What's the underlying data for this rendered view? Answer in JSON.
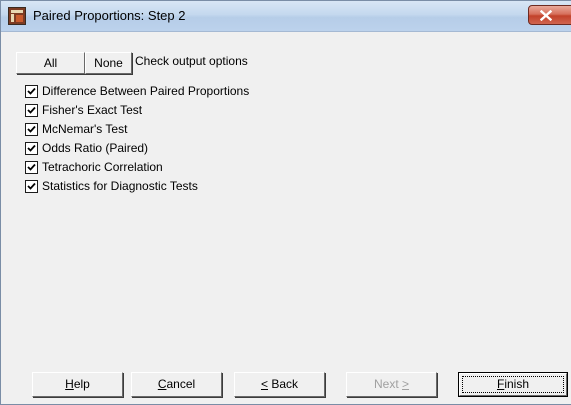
{
  "window": {
    "title": "Paired Proportions: Step 2"
  },
  "toolbar": {
    "all_label": "All",
    "none_label": "None",
    "check_output_label": "Check output options"
  },
  "options": [
    {
      "label": "Difference Between Paired Proportions",
      "checked": true
    },
    {
      "label": "Fisher's Exact Test",
      "checked": true
    },
    {
      "label": "McNemar's Test",
      "checked": true
    },
    {
      "label": "Odds Ratio (Paired)",
      "checked": true
    },
    {
      "label": "Tetrachoric Correlation",
      "checked": true
    },
    {
      "label": "Statistics for Diagnostic Tests",
      "checked": true
    }
  ],
  "buttons": {
    "help": {
      "mnemonic": "H",
      "rest": "elp"
    },
    "cancel": {
      "mnemonic": "C",
      "rest": "ancel"
    },
    "back": {
      "mnemonic": "<",
      "rest": " Back"
    },
    "next": {
      "prefix": "Next ",
      "mnemonic": ">"
    },
    "finish": {
      "mnemonic": "F",
      "rest": "inish",
      "enabled": true
    },
    "next_enabled": false
  },
  "icons": {
    "app": "application-icon",
    "close": "close-icon",
    "check": "check-icon"
  },
  "colors": {
    "close_button": "#c2412a",
    "disabled_text": "#a0a0a0"
  }
}
